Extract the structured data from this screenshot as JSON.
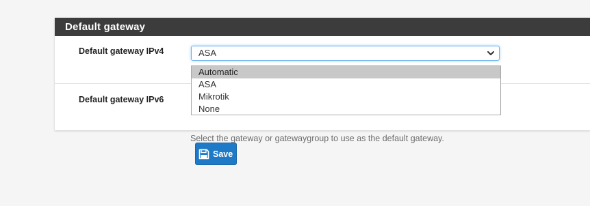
{
  "panel": {
    "title": "Default gateway"
  },
  "ipv4": {
    "label": "Default gateway IPv4",
    "selected": "ASA",
    "options": [
      "Automatic",
      "ASA",
      "Mikrotik",
      "None"
    ],
    "highlighted": "Automatic"
  },
  "ipv6": {
    "label": "Default gateway IPv6",
    "help": "Select the gateway or gatewaygroup to use as the default gateway."
  },
  "save": {
    "label": "Save",
    "icon": "floppy-disk-icon"
  },
  "colors": {
    "heading_bg": "#3c3c3c",
    "button_bg": "#1e7ac6",
    "focus_border": "#66afe9",
    "option_highlight": "#c8c8c8"
  }
}
